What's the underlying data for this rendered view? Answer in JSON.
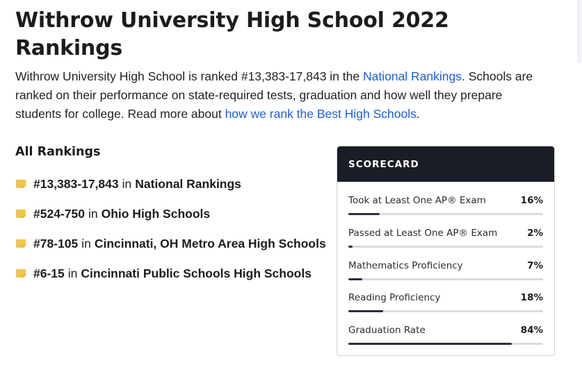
{
  "page": {
    "title": "Withrow University High School 2022 Rankings",
    "intro": {
      "part1": "Withrow University High School is ranked #13,383-17,843 in the ",
      "link1": "National Rankings",
      "part2": ". Schools are ranked on their performance on state-required tests, graduation and how well they prepare students for college. Read more about ",
      "link2": "how we rank the Best High Schools",
      "part3": "."
    }
  },
  "rankings": {
    "heading": "All Rankings",
    "connector": "in",
    "items": [
      {
        "rank": "#13,383-17,843",
        "list": "National Rankings"
      },
      {
        "rank": "#524-750",
        "list": "Ohio High Schools"
      },
      {
        "rank": "#78-105",
        "list": "Cincinnati, OH Metro Area High Schools"
      },
      {
        "rank": "#6-15",
        "list": "Cincinnati Public Schools High Schools"
      }
    ],
    "icon": "ribbon-badge-icon",
    "icon_color": "#f3c44a"
  },
  "scorecard": {
    "heading": "SCORECARD",
    "header_color": "#1b1d26",
    "metrics": [
      {
        "label": "Took at Least One AP® Exam",
        "value": "16%",
        "percent": 16
      },
      {
        "label": "Passed at Least One AP® Exam",
        "value": "2%",
        "percent": 2
      },
      {
        "label": "Mathematics Proficiency",
        "value": "7%",
        "percent": 7
      },
      {
        "label": "Reading Proficiency",
        "value": "18%",
        "percent": 18
      },
      {
        "label": "Graduation Rate",
        "value": "84%",
        "percent": 84
      }
    ]
  },
  "colors": {
    "link": "#1f5fd1",
    "bar_track": "#d9dbe0",
    "bar_fill": "#2a2d3a"
  }
}
